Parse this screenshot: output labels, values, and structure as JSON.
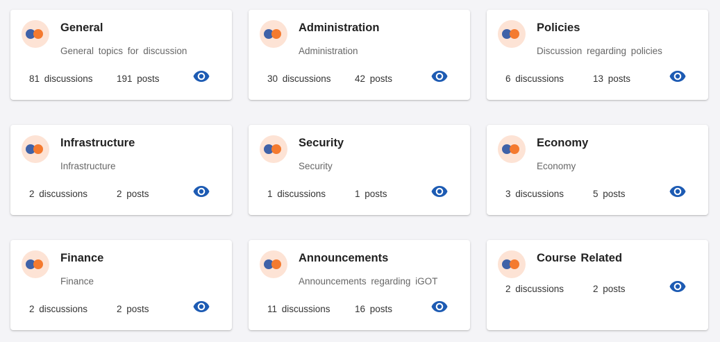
{
  "colors": {
    "page_bg": "#f4f4f7",
    "card_bg": "#ffffff",
    "avatar_bg": "#fde3d5",
    "avatar_blue": "#3f62a8",
    "avatar_orange": "#f47a2f",
    "eye_icon": "#1d5bb3"
  },
  "icons": {
    "avatar": "forum-avatar-icon",
    "view": "eye-icon"
  },
  "categories": [
    {
      "title": "General",
      "description": "General topics for discussion",
      "discussions": "81 discussions",
      "posts": "191 posts"
    },
    {
      "title": "Administration",
      "description": "Administration",
      "discussions": "30 discussions",
      "posts": "42 posts"
    },
    {
      "title": "Policies",
      "description": "Discussion regarding policies",
      "discussions": "6 discussions",
      "posts": "13 posts"
    },
    {
      "title": "Infrastructure",
      "description": "Infrastructure",
      "discussions": "2 discussions",
      "posts": "2 posts"
    },
    {
      "title": "Security",
      "description": "Security",
      "discussions": "1 discussions",
      "posts": "1 posts"
    },
    {
      "title": "Economy",
      "description": "Economy",
      "discussions": "3 discussions",
      "posts": "5 posts"
    },
    {
      "title": "Finance",
      "description": "Finance",
      "discussions": "2 discussions",
      "posts": "2 posts"
    },
    {
      "title": "Announcements",
      "description": "Announcements regarding iGOT",
      "discussions": "11 discussions",
      "posts": "16 posts"
    },
    {
      "title": "Course Related",
      "discussions": "2 discussions",
      "posts": "2 posts"
    }
  ]
}
